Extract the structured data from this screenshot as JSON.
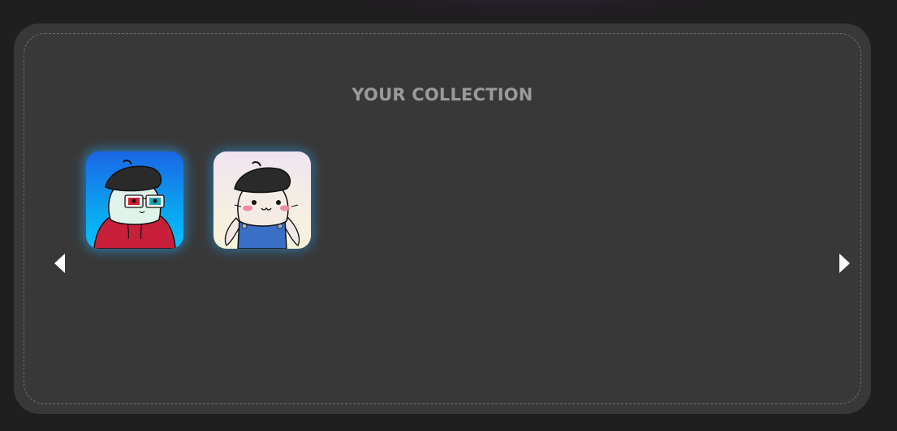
{
  "collection": {
    "title": "YOUR COLLECTION",
    "items": [
      {
        "name": "seal-red-hoodie-3d-glasses-beret"
      },
      {
        "name": "seal-blue-overalls-beret"
      }
    ]
  },
  "colors": {
    "page_background": "#1f1f1f",
    "panel_background": "#383838",
    "panel_border": "#6e6e6e",
    "title_text": "#9a9a9a",
    "card_glow": "#28aaff",
    "arrow": "#ffffff"
  },
  "icons": {
    "prev": "caret-left-icon",
    "next": "caret-right-icon"
  }
}
